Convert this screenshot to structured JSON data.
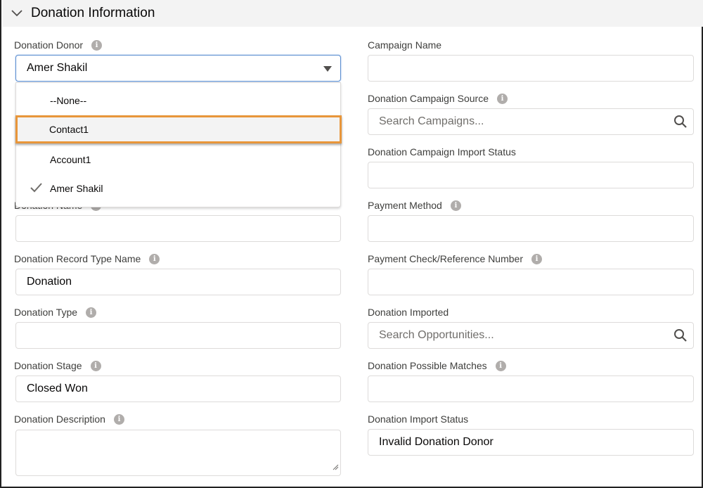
{
  "section": {
    "title": "Donation Information",
    "collapse_icon": "chevron-down-icon"
  },
  "left": {
    "donor": {
      "label": "Donation Donor",
      "value": "Amer Shakil"
    },
    "dropdown_options": [
      {
        "label": "--None--",
        "selected": false,
        "highlighted": false
      },
      {
        "label": "Contact1",
        "selected": false,
        "highlighted": true
      },
      {
        "label": "Account1",
        "selected": false,
        "highlighted": false
      },
      {
        "label": "Amer Shakil",
        "selected": true,
        "highlighted": false
      }
    ],
    "donation_name": {
      "label": "Donation Name",
      "value": ""
    },
    "record_type": {
      "label": "Donation Record Type Name",
      "value": "Donation"
    },
    "type": {
      "label": "Donation Type",
      "value": ""
    },
    "stage": {
      "label": "Donation Stage",
      "value": "Closed Won"
    },
    "description": {
      "label": "Donation Description",
      "value": ""
    }
  },
  "right": {
    "campaign_name": {
      "label": "Campaign Name",
      "value": ""
    },
    "campaign_source": {
      "label": "Donation Campaign Source",
      "placeholder": "Search Campaigns..."
    },
    "campaign_import_status": {
      "label": "Donation Campaign Import Status",
      "value": ""
    },
    "payment_method": {
      "label": "Payment Method",
      "value": ""
    },
    "payment_ref": {
      "label": "Payment Check/Reference Number",
      "value": ""
    },
    "donation_imported": {
      "label": "Donation Imported",
      "placeholder": "Search Opportunities..."
    },
    "possible_matches": {
      "label": "Donation Possible Matches",
      "value": ""
    },
    "import_status": {
      "label": "Donation Import Status",
      "value": "Invalid Donation Donor"
    }
  },
  "colors": {
    "highlight": "#e8963a",
    "focus_border": "#5a8dd0",
    "header_bg": "#f3f3f3"
  }
}
